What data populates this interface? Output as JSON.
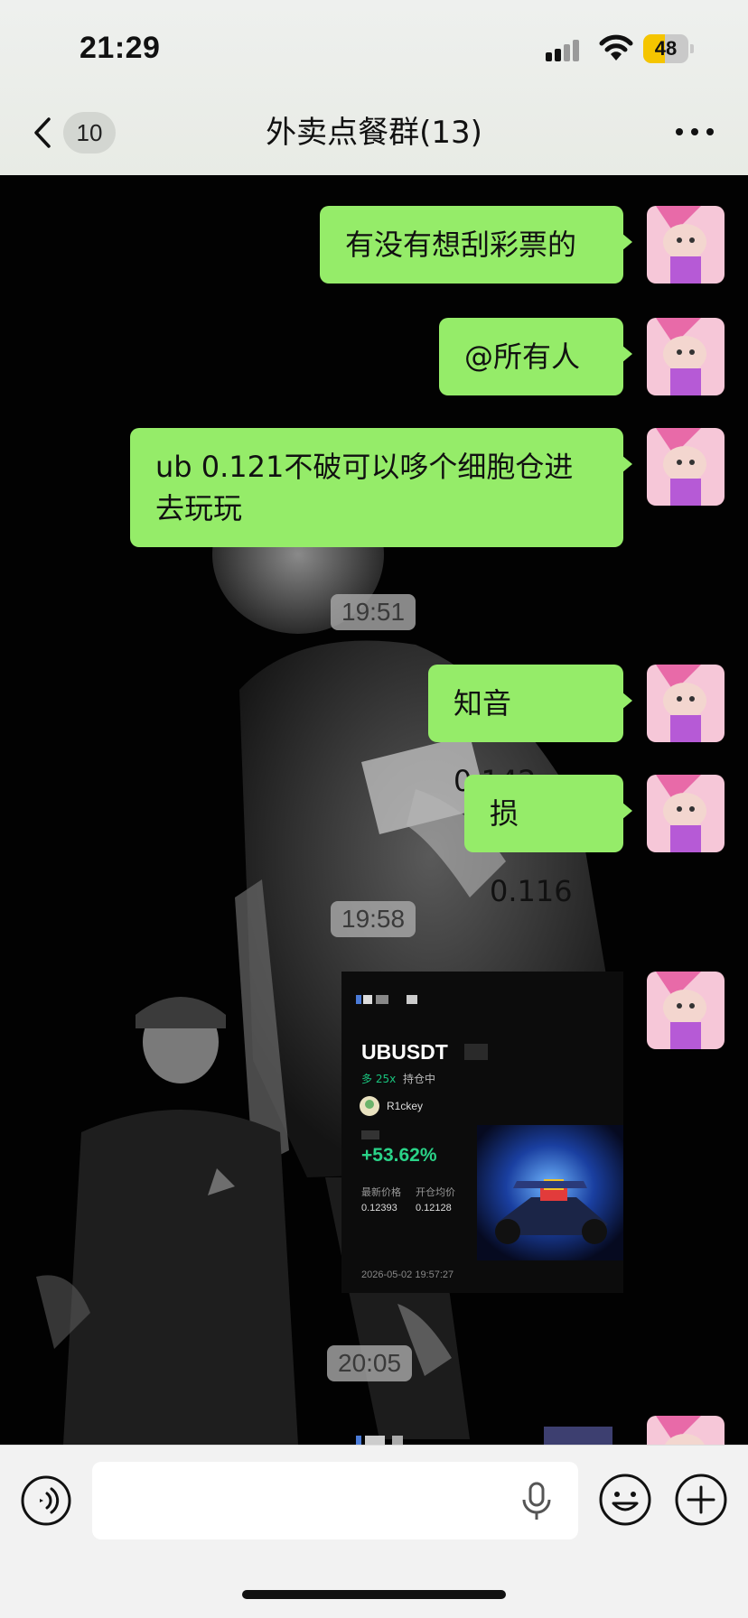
{
  "status_bar": {
    "time": "21:29",
    "battery_level": "48",
    "battery_fraction": 0.48,
    "icons": [
      "cellular-signal-icon",
      "wifi-icon",
      "battery-icon"
    ]
  },
  "nav": {
    "back_icon": "chevron-left-icon",
    "unread_count": "10",
    "title": "外卖点餐群(13)",
    "more_icon": "more-dots-icon"
  },
  "messages": [
    {
      "type": "text",
      "text": "有没有想刮彩票的"
    },
    {
      "type": "text",
      "text": "@所有人"
    },
    {
      "type": "text",
      "line1": "ub 0.121不破可以哆个细胞仓进",
      "line2": "去玩玩"
    },
    {
      "type": "time",
      "text": "19:51"
    },
    {
      "type": "text",
      "text": "知音 0.142"
    },
    {
      "type": "text",
      "text": "损 0.116"
    },
    {
      "type": "time",
      "text": "19:58"
    },
    {
      "type": "image",
      "card": {
        "pair": "UBUSDT",
        "leverage": "多 25x",
        "status": "持仓中",
        "username": "R1ckey",
        "pnl": "+53.62%",
        "last_price_label": "最新价格",
        "entry_price_label": "开仓均价",
        "last_price": "0.12393",
        "entry_price": "0.12128",
        "datetime": "2026-05-02 19:57:27"
      }
    },
    {
      "type": "time",
      "text": "20:05"
    }
  ],
  "input_bar": {
    "voice_icon": "voice-input-icon",
    "mic_icon": "microphone-icon",
    "emoji_icon": "emoji-icon",
    "plus_icon": "plus-icon"
  },
  "colors": {
    "bubble": "#95ec69",
    "chat_background": "#020202",
    "pnl_green": "#2ad388",
    "battery": "#f5c500"
  }
}
